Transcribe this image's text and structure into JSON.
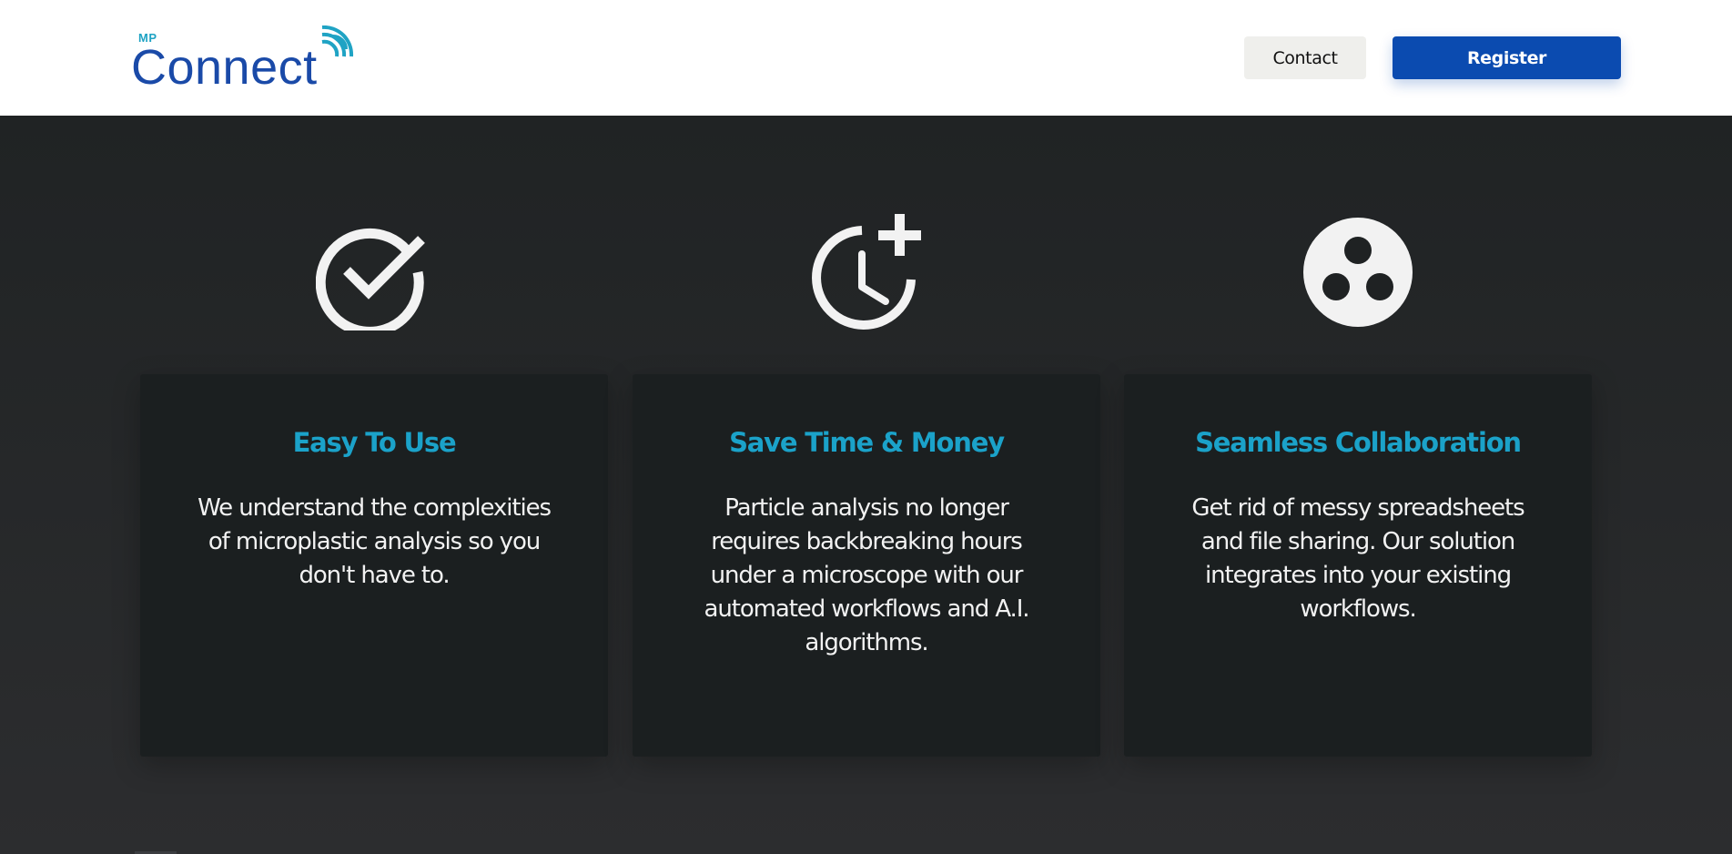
{
  "header": {
    "logo": {
      "prefix": "MP",
      "wordmark": "Connect",
      "brand_color": "#1a4aa8",
      "accent_color": "#1fa3c4"
    },
    "contact_label": "Contact",
    "register_label": "Register"
  },
  "features": [
    {
      "icon": "check-circle-icon",
      "title": "Easy To Use",
      "text": "We understand the complexities of microplastic analysis so you don't have to."
    },
    {
      "icon": "clock-plus-icon",
      "title": "Save Time & Money",
      "text": "Particle analysis no longer requires backbreaking hours under a microscope with our automated workflows and A.I. algorithms."
    },
    {
      "icon": "collaboration-circle-icon",
      "title": "Seamless Collaboration",
      "text": "Get rid of messy spreadsheets and file sharing. Our solution integrates into your existing workflows."
    }
  ],
  "colors": {
    "title_accent": "#1ba2c9",
    "register_button": "#0b4bb0",
    "section_background": "#2a2c2e",
    "card_background": "#1b1f20"
  }
}
